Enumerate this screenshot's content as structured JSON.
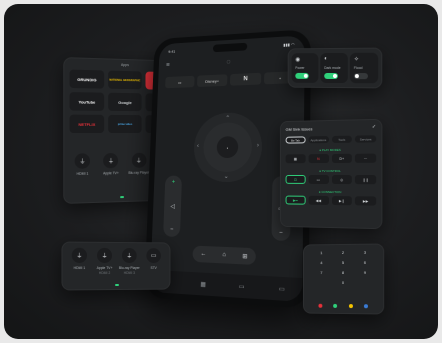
{
  "phone": {
    "time": "9:41",
    "signal": "▮▮▮ ◠",
    "top_pills": [
      "▭",
      "Disney+",
      "N",
      "+"
    ],
    "ok_label": "•",
    "nav_icons": [
      "←",
      "⌂",
      "⊞"
    ]
  },
  "apps_card": {
    "title": "Apps",
    "apps": [
      {
        "label": "GRUNDIG",
        "color": "#ffffff",
        "bg": "#1b1c1e"
      },
      {
        "label": "NATIONAL GEOGRAPHIC",
        "color": "#f5c400",
        "bg": "#1b1c1e"
      },
      {
        "label": "TLC",
        "color": "#ffffff",
        "bg": "#e6313a"
      },
      {
        "label": "YouTube",
        "color": "#ffffff",
        "bg": "#1b1c1e"
      },
      {
        "label": "Google",
        "color": "#cfd3d6",
        "bg": "#1b1c1e"
      },
      {
        "label": "Spotify",
        "color": "#2fd07a",
        "bg": "#1b1c1e"
      },
      {
        "label": "NETFLIX",
        "color": "#e6313a",
        "bg": "#1b1c1e"
      },
      {
        "label": "prime video",
        "color": "#4aa8e8",
        "bg": "#1b1c1e"
      },
      {
        "label": "Disney+",
        "color": "#ffffff",
        "bg": "#1b1c1e"
      }
    ],
    "inputs": [
      "HDMI 1",
      "Apple TV+",
      "Blu-ray Player",
      "STV"
    ]
  },
  "toggles": [
    {
      "icon": "◉",
      "label": "Power",
      "on": true
    },
    {
      "icon": "◐",
      "label": "Dark mode",
      "on": true
    },
    {
      "icon": "✧",
      "label": "Flood",
      "on": false
    }
  ],
  "device_card": {
    "title": "GM Sink Issues",
    "tabs": [
      "Be Tab",
      "Applications",
      "Tools",
      "Services"
    ],
    "section1": "● PLAY MODES",
    "section2": "● TV CONTROL",
    "section3": "● CONNECTION"
  },
  "inputs_card": {
    "items": [
      "HDMI 1",
      "Apple TV+",
      "Blu-ray Player",
      "STV"
    ],
    "subs": [
      "",
      "HDMI 2",
      "HDMI 3",
      ""
    ]
  },
  "numpad": {
    "keys": [
      "1",
      "2",
      "3",
      "4",
      "5",
      "6",
      "7",
      "8",
      "9",
      "",
      "0",
      ""
    ],
    "dot_colors": [
      "#e6313a",
      "#2fd07a",
      "#f5c400",
      "#3a7bd5"
    ]
  }
}
